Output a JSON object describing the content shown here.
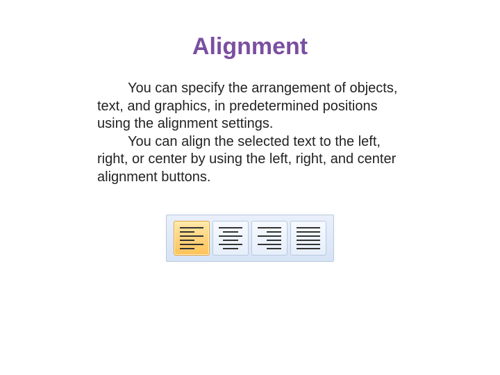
{
  "title": "Alignment",
  "paragraphs": [
    "You can specify the arrangement of objects, text, and graphics, in predetermined positions using the alignment settings.",
    "You can align the selected text to the left, right, or center by using the left, right, and center alignment buttons."
  ],
  "toolbar": {
    "buttons": [
      {
        "name": "align-left",
        "active": true
      },
      {
        "name": "align-center",
        "active": false
      },
      {
        "name": "align-right",
        "active": false
      },
      {
        "name": "align-justify",
        "active": false
      }
    ]
  }
}
